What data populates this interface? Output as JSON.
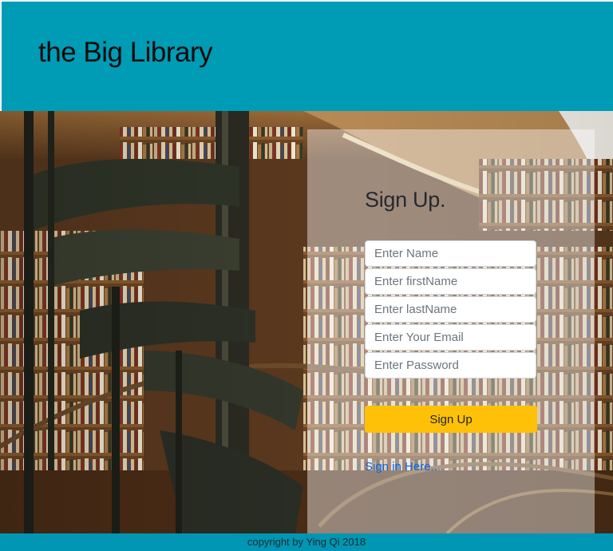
{
  "header": {
    "brand": "the Big Library"
  },
  "hero": {
    "image": "library-spiral-staircase-photo"
  },
  "signup": {
    "title": "Sign Up.",
    "fields": {
      "name_placeholder": "Enter Name",
      "firstname_placeholder": "Enter firstName",
      "lastname_placeholder": "Enter lastName",
      "email_placeholder": "Enter Your Email",
      "password_placeholder": "Enter Password"
    },
    "button_label": "Sign Up",
    "signin_link": "Sign in Here..."
  },
  "footer": {
    "text": "copyright by Ying Qi 2018"
  },
  "colors": {
    "header_bg": "#009bb5",
    "button_bg": "#ffc107",
    "link": "#0a66e6"
  }
}
